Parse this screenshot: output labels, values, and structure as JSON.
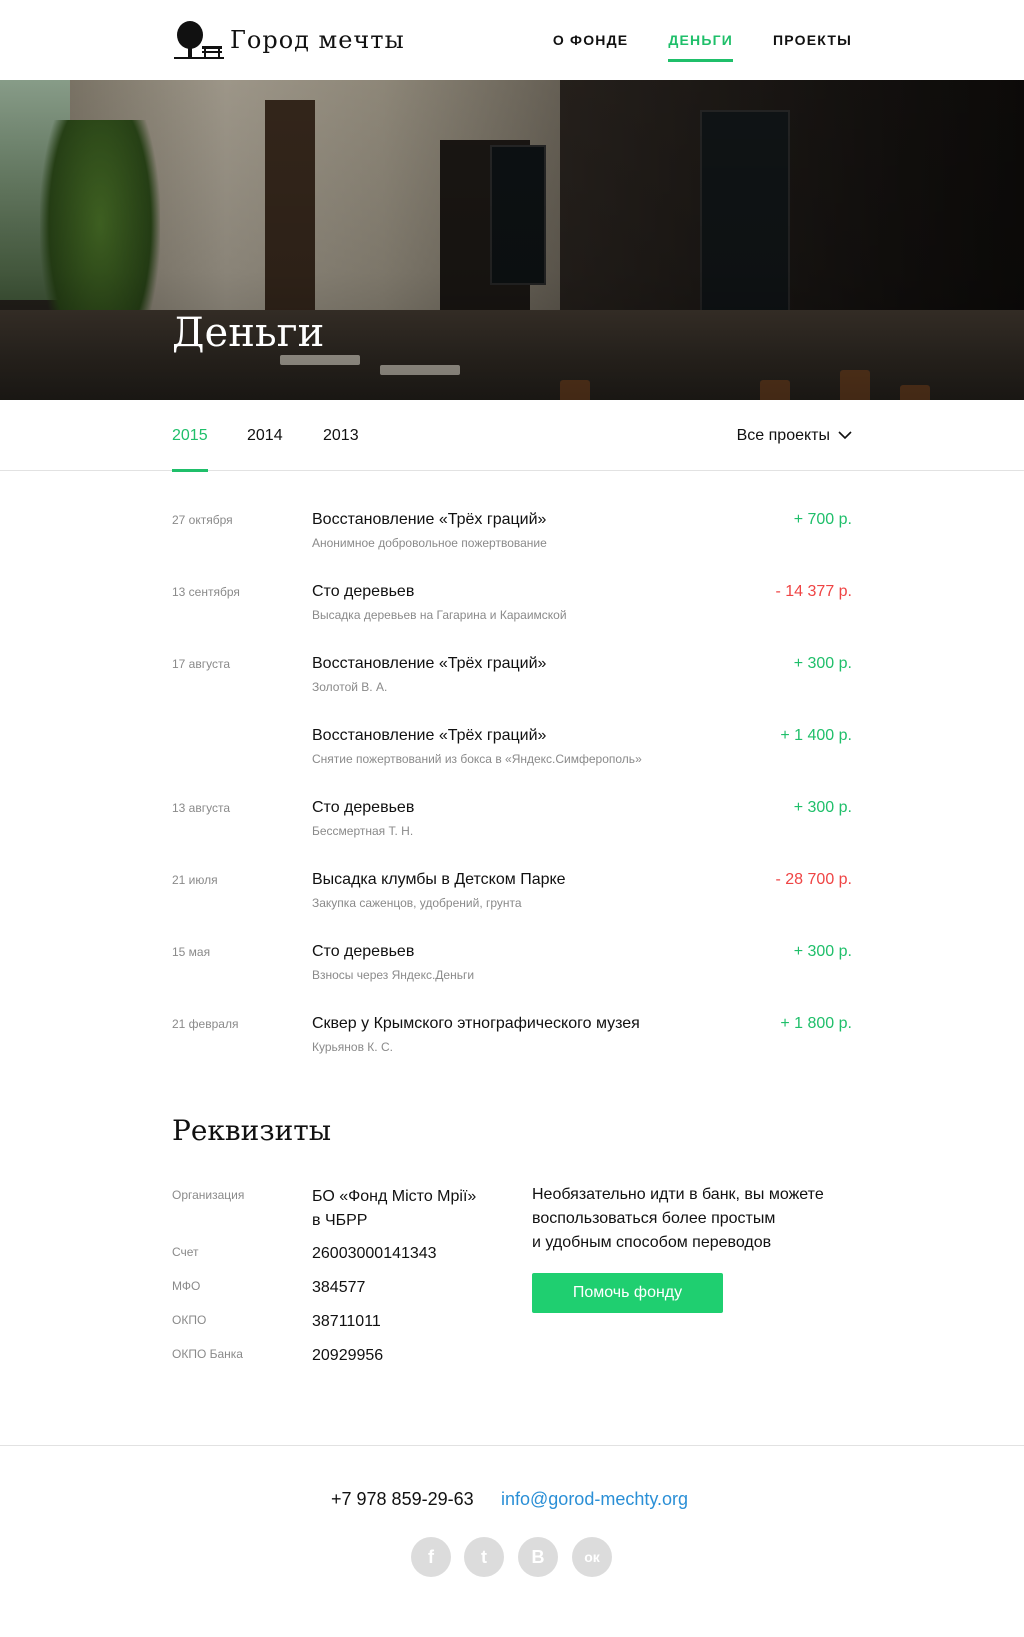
{
  "header": {
    "logo_text": "Город мечты",
    "nav": [
      {
        "label": "О фонде",
        "active": false
      },
      {
        "label": "Деньги",
        "active": true
      },
      {
        "label": "Проекты",
        "active": false
      }
    ]
  },
  "hero": {
    "title": "Деньги"
  },
  "tabs": {
    "years": [
      {
        "label": "2015",
        "active": true
      },
      {
        "label": "2014",
        "active": false
      },
      {
        "label": "2013",
        "active": false
      }
    ],
    "filter_label": "Все проекты"
  },
  "transactions": [
    {
      "date": "27 октября",
      "title": "Восстановление «Трёх граций»",
      "subtitle": "Анонимное добровольное пожертвование",
      "amount": "+ 700 р.",
      "type": "income"
    },
    {
      "date": "13 сентября",
      "title": "Сто деревьев",
      "subtitle": "Высадка деревьев на Гагарина и Караимской",
      "amount": "- 14 377 р.",
      "type": "expense"
    },
    {
      "date": "17 августа",
      "title": "Восстановление «Трёх граций»",
      "subtitle": "Золотой В. А.",
      "amount": "+ 300 р.",
      "type": "income"
    },
    {
      "date": "",
      "title": "Восстановление «Трёх граций»",
      "subtitle": "Снятие пожертвований из бокса в «Яндекс.Симферополь»",
      "amount": "+ 1 400 р.",
      "type": "income"
    },
    {
      "date": "13 августа",
      "title": "Сто деревьев",
      "subtitle": "Бессмертная Т. Н.",
      "amount": "+ 300 р.",
      "type": "income"
    },
    {
      "date": "21 июля",
      "title": "Высадка клумбы в Детском Парке",
      "subtitle": "Закупка саженцов, удобрений, грунта",
      "amount": "- 28 700 р.",
      "type": "expense"
    },
    {
      "date": "15 мая",
      "title": "Сто деревьев",
      "subtitle": "Взносы через Яндекс.Деньги",
      "amount": "+ 300 р.",
      "type": "income"
    },
    {
      "date": "21 февраля",
      "title": "Сквер у Крымского этнографического музея",
      "subtitle": "Курьянов К. С.",
      "amount": "+ 1 800 р.",
      "type": "income"
    }
  ],
  "requisites": {
    "title": "Реквизиты",
    "rows": [
      {
        "label": "Организация",
        "value_line1": "БО «Фонд Місто Мрії»",
        "value_line2": "в ЧБРР"
      },
      {
        "label": "Счет",
        "value_line1": "26003000141343",
        "value_line2": ""
      },
      {
        "label": "МФО",
        "value_line1": "384577",
        "value_line2": ""
      },
      {
        "label": "ОКПО",
        "value_line1": "38711011",
        "value_line2": ""
      },
      {
        "label": "ОКПО Банка",
        "value_line1": "20929956",
        "value_line2": ""
      }
    ],
    "note_lines": [
      "Необязательно идти в банк, вы можете",
      "воспользоваться более простым",
      "и удобным способом переводов"
    ],
    "button_label": "Помочь фонду"
  },
  "footer": {
    "phone": "+7 978 859-29-63",
    "email": "info@gorod-mechty.org",
    "social": [
      {
        "icon": "facebook-icon",
        "glyph": "f"
      },
      {
        "icon": "twitter-icon",
        "glyph": "t"
      },
      {
        "icon": "vk-icon",
        "glyph": "B"
      },
      {
        "icon": "odnoklassniki-icon",
        "glyph": "ок"
      }
    ]
  },
  "colors": {
    "accent": "#1fbf6a",
    "expense": "#ef4444",
    "link": "#2a8fd6",
    "social": "#dcdcdc"
  }
}
